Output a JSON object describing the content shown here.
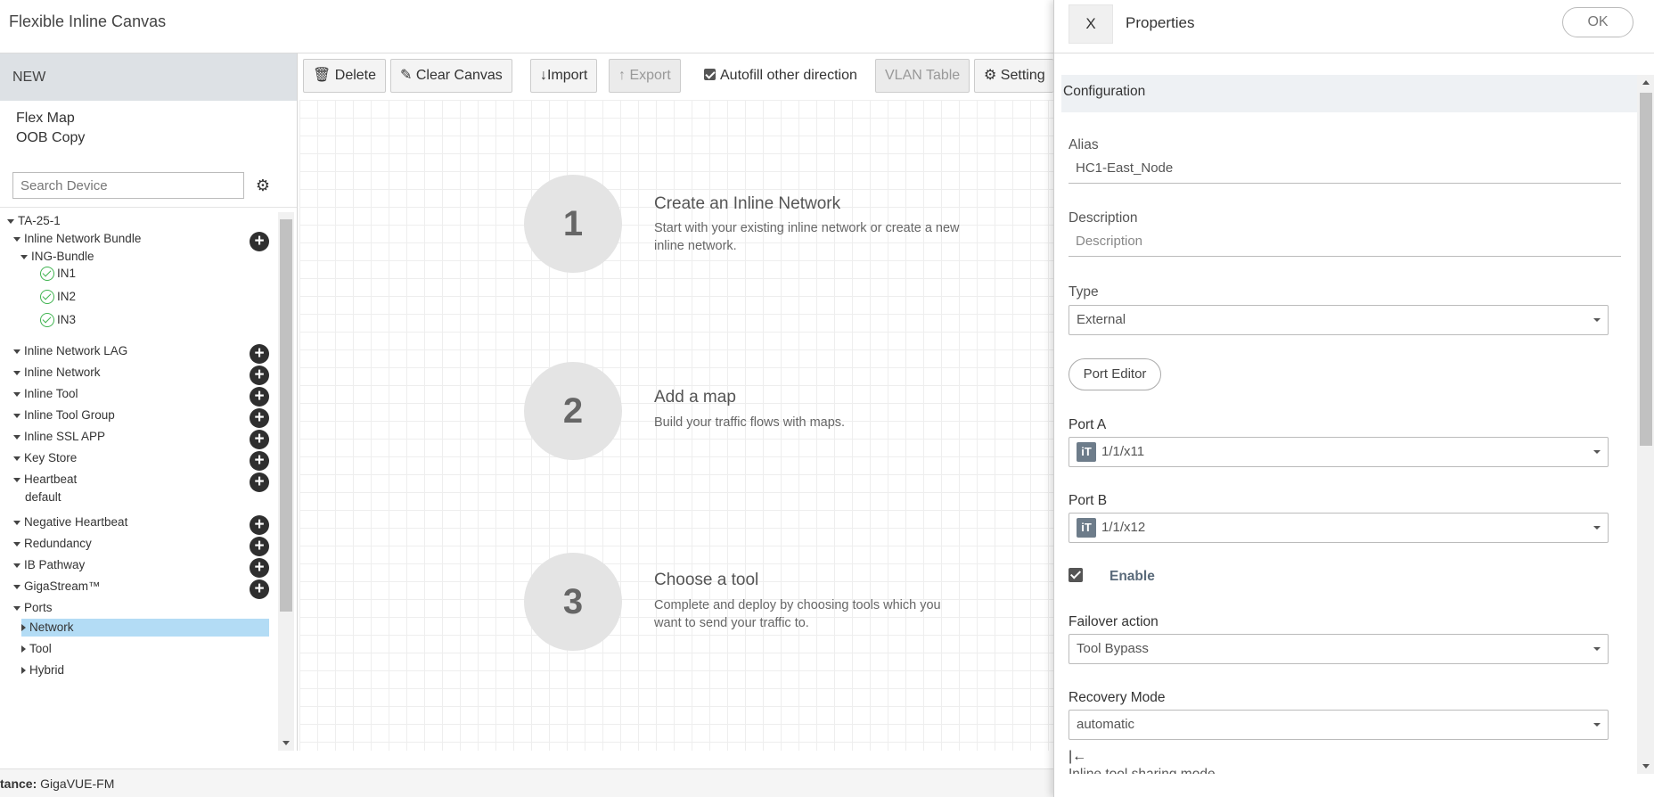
{
  "app": {
    "title": "Flexible Inline Canvas"
  },
  "sidebar": {
    "new_label": "NEW",
    "links": [
      "Flex Map",
      "OOB Copy"
    ],
    "search_placeholder": "Search Device",
    "tree": {
      "root": "TA-25-1",
      "inline_network_bundle": "Inline Network Bundle",
      "ing_bundle": "ING-Bundle",
      "bundle_items": [
        "IN1",
        "IN2",
        "IN3"
      ],
      "inline_network_lag": "Inline Network LAG",
      "inline_network": "Inline Network",
      "inline_tool": "Inline Tool",
      "inline_tool_group": "Inline Tool Group",
      "inline_ssl_app": "Inline SSL APP",
      "key_store": "Key Store",
      "heartbeat": "Heartbeat",
      "heartbeat_default": "default",
      "negative_heartbeat": "Negative Heartbeat",
      "redundancy": "Redundancy",
      "ib_pathway": "IB Pathway",
      "gigastream": "GigaStream™",
      "ports": "Ports",
      "port_children": [
        "Network",
        "Tool",
        "Hybrid"
      ]
    }
  },
  "toolbar": {
    "delete": "Delete",
    "clear_canvas": "Clear Canvas",
    "import": "Import",
    "export": "Export",
    "autofill": "Autofill other direction",
    "vlan_table": "VLAN Table",
    "settings": "Setting"
  },
  "canvas": {
    "steps": [
      {
        "number": "1",
        "title": "Create an Inline Network",
        "desc": "Start with your existing inline network or create a new inline network."
      },
      {
        "number": "2",
        "title": "Add a map",
        "desc": "Build your traffic flows with maps."
      },
      {
        "number": "3",
        "title": "Choose a tool",
        "desc": "Complete and deploy by choosing tools which you want to send your traffic to."
      }
    ]
  },
  "footer": {
    "prefix": "tance:",
    "value": "GigaVUE-FM"
  },
  "properties": {
    "close": "X",
    "title": "Properties",
    "ok": "OK",
    "section": "Configuration",
    "alias_label": "Alias",
    "alias_value": "HC1-East_Node",
    "description_label": "Description",
    "description_placeholder": "Description",
    "type_label": "Type",
    "type_value": "External",
    "port_editor": "Port Editor",
    "port_a_label": "Port A",
    "port_a_value": "1/1/x11",
    "port_b_label": "Port B",
    "port_b_value": "1/1/x12",
    "port_icon_text": "iT",
    "enable_label": "Enable",
    "failover_label": "Failover action",
    "failover_value": "Tool Bypass",
    "recovery_label": "Recovery Mode",
    "recovery_value": "automatic",
    "collapse_glyph": "|←",
    "next_label_cut": "Inline tool sharing mode"
  }
}
